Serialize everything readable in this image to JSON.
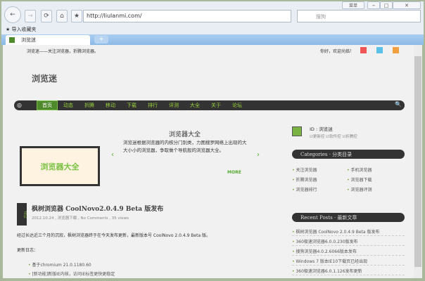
{
  "browser": {
    "menu_label": "菜单",
    "url": "http://liulanmi.com/",
    "search_placeholder": "搜狗",
    "favorites_import": "导入收藏夹",
    "tab_title": "浏览迷",
    "new_tab": "+"
  },
  "site": {
    "tagline": "浏览迷——关注浏览器，折腾浏览器。",
    "welcome": "你好，欢迎光临！",
    "logo": "浏览迷",
    "nav": [
      "首页",
      "动态",
      "折腾",
      "移动",
      "下载",
      "排行",
      "评测",
      "大全",
      "关于",
      "论坛"
    ],
    "feature": {
      "title": "浏览器大全",
      "text": "浏览迷根据浏览器的内核分门别类，力图搜罗网络上出现的大大小小的浏览器，争取做个导航般的浏览器大全。",
      "banner_text": "浏览器大全",
      "more": "MORE"
    },
    "post": {
      "badge": "TITLE",
      "title": "枫树浏览器 CoolNovo2.0.4.9 Beta 版发布",
      "meta": "2012.10.24 , 浏览器下载 , No Comments , 35 views",
      "intro": "经过长达近三个月的沉寂，枫树浏览器终于在今天发布更新，最新版本号 CoolNovo 2.0.4.9 Beta 版。",
      "changelog_label": "更新日志：",
      "changes": [
        "基于chromium 21.0.1180.60",
        "[新功能]新版IE内核，访问IE标签更快更稳定"
      ]
    },
    "sidebar": {
      "id": "ID : 浏览迷",
      "checks": "☑更新控 ☑软件控 ☑折腾控",
      "categories_title": "Categories · 分类目录",
      "categories": [
        "关注浏览器",
        "手机浏览器",
        "折腾浏览器",
        "浏览器下载",
        "浏览器排行",
        "浏览器评测"
      ],
      "recent_title": "Recent Posts · 最新文章",
      "recent": [
        "枫树浏览器 CoolNovo 2.0.4.9 Beta 版发布",
        "360极速浏览器6.0.0.230版发布",
        "搜狗浏览器4.0.2.6066版本发布",
        "Windows 7 版本IE10下载页已经出现",
        "360极速浏览器6.0.1.126发布更新"
      ]
    }
  }
}
